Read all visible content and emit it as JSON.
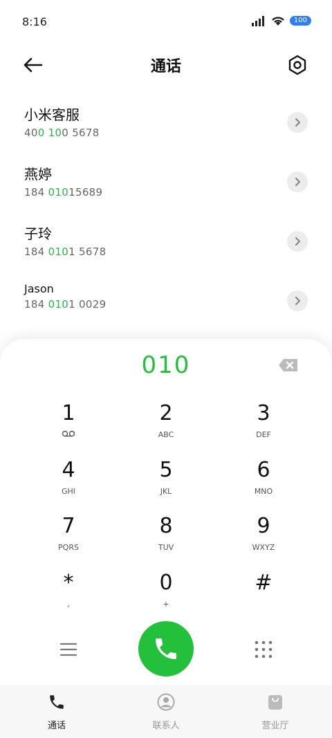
{
  "status": {
    "time": "8:16",
    "battery": "100"
  },
  "header": {
    "title": "通话"
  },
  "contacts": [
    {
      "name": "小米客服",
      "num_pre": "40",
      "num_hl1": "0",
      "num_mid": " ",
      "num_hl2": "10",
      "num_post": "0 5678"
    },
    {
      "name": "燕婷",
      "num_pre": "184 ",
      "num_hl1": "010",
      "num_mid": "",
      "num_hl2": "",
      "num_post": "15689"
    },
    {
      "name": "子玲",
      "num_pre": "184 ",
      "num_hl1": "010",
      "num_mid": "",
      "num_hl2": "",
      "num_post": "1 5678"
    },
    {
      "name": "Jason",
      "num_pre": "184 ",
      "num_hl1": "010",
      "num_mid": "",
      "num_hl2": "",
      "num_post": "1 0029"
    }
  ],
  "dialpad": {
    "dialed": "010",
    "keys": [
      {
        "digit": "1",
        "sub": "voicemail"
      },
      {
        "digit": "2",
        "sub": "ABC"
      },
      {
        "digit": "3",
        "sub": "DEF"
      },
      {
        "digit": "4",
        "sub": "GHI"
      },
      {
        "digit": "5",
        "sub": "JKL"
      },
      {
        "digit": "6",
        "sub": "MNO"
      },
      {
        "digit": "7",
        "sub": "PQRS"
      },
      {
        "digit": "8",
        "sub": "TUV"
      },
      {
        "digit": "9",
        "sub": "WXYZ"
      },
      {
        "digit": "*",
        "sub": ","
      },
      {
        "digit": "0",
        "sub": "+"
      },
      {
        "digit": "#",
        "sub": ""
      }
    ]
  },
  "bottom_nav": {
    "calls": "通话",
    "contacts": "联系人",
    "store": "营业厅"
  },
  "colors": {
    "accent": "#22c03b",
    "battery": "#2f7df6"
  },
  "icons": {
    "back": "arrow-left-icon",
    "settings": "hexagon-settings-icon",
    "call": "phone-icon",
    "menu": "menu-icon",
    "keypad": "keypad-icon",
    "backspace": "backspace-icon"
  }
}
